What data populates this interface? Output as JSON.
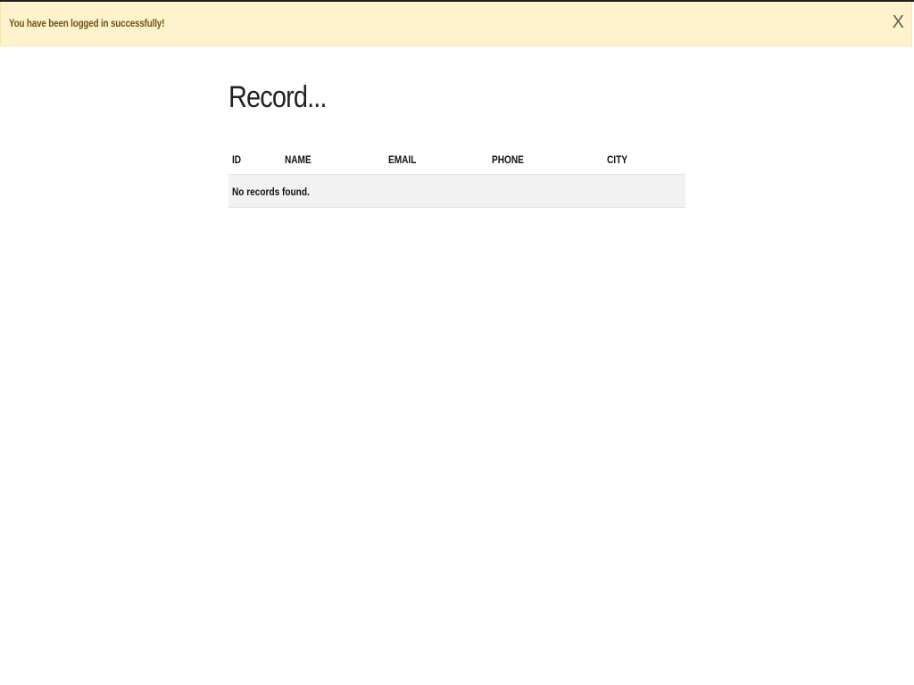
{
  "alert": {
    "message": "You have been logged in successfully!",
    "close_label": "X"
  },
  "page": {
    "title": "Record..."
  },
  "table": {
    "columns": [
      "ID",
      "NAME",
      "EMAIL",
      "PHONE",
      "CITY"
    ],
    "empty_message": "No records found."
  },
  "colors": {
    "alert_background": "#fff3cd",
    "alert_text": "#6b5412",
    "empty_row_background": "#f2f2f2"
  }
}
